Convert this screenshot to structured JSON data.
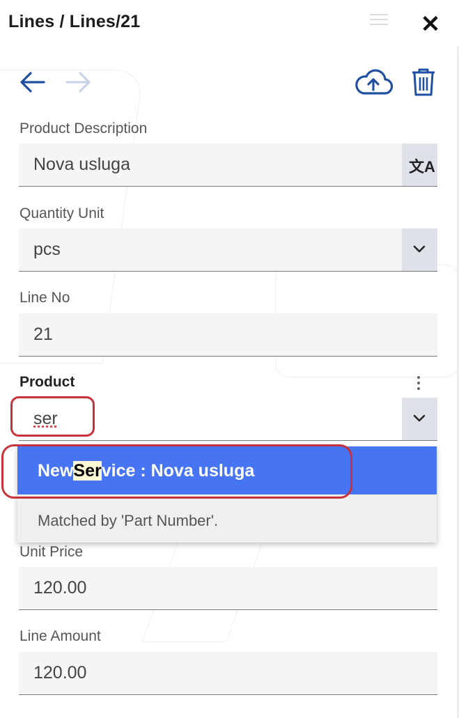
{
  "header": {
    "title": "Lines / Lines/21"
  },
  "icons": {
    "menu": "menu-icon",
    "close": "close-icon",
    "back": "arrow-left-icon",
    "forward": "arrow-right-icon",
    "upload": "cloud-upload-icon",
    "delete": "trash-icon",
    "translate": "translate-icon",
    "chevron": "chevron-down-icon",
    "more": "kebab-icon"
  },
  "colors": {
    "accent": "#1f4fa0",
    "highlight_option": "#4774f2",
    "annotation": "#c8323a"
  },
  "form": {
    "product_description": {
      "label": "Product Description",
      "value": "Nova usluga"
    },
    "quantity_unit": {
      "label": "Quantity Unit",
      "value": "pcs"
    },
    "line_no": {
      "label": "Line No",
      "value": "21"
    },
    "product": {
      "label": "Product",
      "value": "ser"
    },
    "unit_price": {
      "label": "Unit Price",
      "value": "120.00"
    },
    "line_amount": {
      "label": "Line Amount",
      "value": "120.00"
    }
  },
  "dropdown": {
    "option": {
      "prefix": "New",
      "match": "Ser",
      "suffix": "vice : Nova usluga"
    },
    "matched_text": "Matched by 'Part Number'."
  }
}
